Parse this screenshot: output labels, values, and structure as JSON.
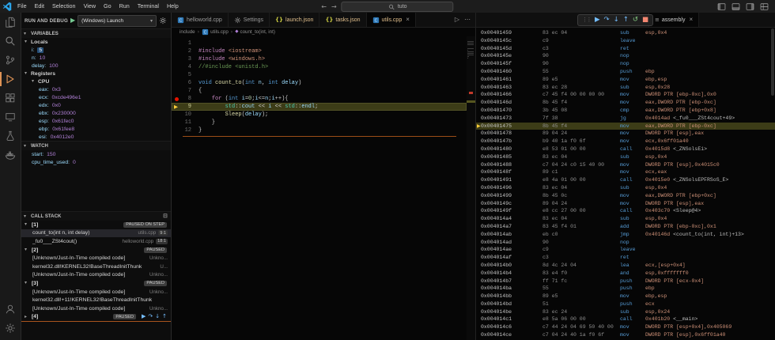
{
  "icons": {
    "close": "×",
    "chevron_down": "▾",
    "chevron_right": "▸",
    "crumb_sep": "›",
    "run": "▷",
    "more": "⋯",
    "collapse_all": "⊟",
    "dropdown": "▾",
    "back": "←",
    "forward": "→",
    "disassembly_view": "≡",
    "drag_handle": "⋮⋮"
  },
  "title_bar": {
    "menus": [
      "File",
      "Edit",
      "Selection",
      "View",
      "Go",
      "Run",
      "Terminal",
      "Help"
    ],
    "command_center": "tuto"
  },
  "activity_bar": {
    "items": [
      {
        "name": "explorer",
        "active": false
      },
      {
        "name": "search",
        "active": false
      },
      {
        "name": "source-control",
        "active": false
      },
      {
        "name": "run-and-debug",
        "active": true
      },
      {
        "name": "extensions",
        "active": false
      },
      {
        "name": "remote-explorer",
        "active": false
      },
      {
        "name": "testing",
        "active": false
      },
      {
        "name": "docker",
        "active": false
      }
    ],
    "bottom_items": [
      {
        "name": "accounts"
      },
      {
        "name": "settings"
      }
    ]
  },
  "run_and_debug": {
    "title": "RUN AND DEBUG",
    "launch_config": "(Windows) Launch",
    "variables": {
      "label": "VARIABLES",
      "rows": [
        {
          "kind": "group",
          "label": "Locals",
          "depth": 0
        },
        {
          "kind": "var",
          "name": "i",
          "value": "5",
          "depth": 1,
          "selected": true
        },
        {
          "kind": "var",
          "name": "n",
          "value": "10",
          "depth": 1
        },
        {
          "kind": "var",
          "name": "delay",
          "value": "100",
          "depth": 1
        },
        {
          "kind": "group",
          "label": "Registers",
          "depth": 0
        },
        {
          "kind": "group",
          "label": "CPU",
          "depth": 1
        },
        {
          "kind": "var",
          "name": "eax",
          "value": "0x3",
          "depth": 2
        },
        {
          "kind": "var",
          "name": "ecx",
          "value": "0xcde496e1",
          "depth": 2
        },
        {
          "kind": "var",
          "name": "edx",
          "value": "0x0",
          "depth": 2
        },
        {
          "kind": "var",
          "name": "ebx",
          "value": "0x230000",
          "depth": 2
        },
        {
          "kind": "var",
          "name": "esp",
          "value": "0x61fec0",
          "depth": 2
        },
        {
          "kind": "var",
          "name": "ebp",
          "value": "0x61fee8",
          "depth": 2
        },
        {
          "kind": "var",
          "name": "esi",
          "value": "0x4012e0",
          "depth": 2
        }
      ]
    },
    "watch": {
      "label": "WATCH",
      "rows": [
        {
          "kind": "var",
          "name": "start",
          "value": "150",
          "depth": 1
        },
        {
          "kind": "var",
          "name": "cpu_time_used",
          "value": "0",
          "depth": 1
        }
      ]
    },
    "call_stack": {
      "label": "CALL STACK",
      "threads": [
        {
          "label": "[1]",
          "status": "PAUSED ON STEP",
          "expanded": true,
          "frames": [
            {
              "name": "count_to(int n, int delay)",
              "file": "utils.cpp",
              "line": "9:1",
              "current": true
            },
            {
              "name": "_fu0___ZSt4cout()",
              "file": "helloworld.cpp",
              "line": "18:1"
            }
          ]
        },
        {
          "label": "[2]",
          "status": "PAUSED",
          "expanded": true,
          "frames": [
            {
              "name": "[Unknown/Just-In-Time compiled code]",
              "file": "Unkno..."
            },
            {
              "name": "kernel32.dll!KERNEL32!BaseThreadInitThunk",
              "file": "U..."
            },
            {
              "name": "[Unknown/Just-In-Time compiled code]",
              "file": "Unkno..."
            }
          ]
        },
        {
          "label": "[3]",
          "status": "PAUSED",
          "expanded": true,
          "frames": [
            {
              "name": "[Unknown/Just-In-Time compiled code]",
              "file": "Unkno..."
            },
            {
              "name": "kernel32.dll!+11!KERNEL32!BaseThreadInitThunk",
              "file": ""
            },
            {
              "name": "[Unknown/Just-In-Time compiled code]",
              "file": "Unkno..."
            }
          ]
        },
        {
          "label": "[4]",
          "status": "PAUSED",
          "expanded": false,
          "show_toolbar": true,
          "frames": []
        }
      ]
    }
  },
  "editor": {
    "tabs": [
      {
        "label": "helloworld.cpp",
        "icon": "cpp",
        "dirty": false,
        "active": false
      },
      {
        "label": "Settings",
        "icon": "gear",
        "dirty": false,
        "active": false
      },
      {
        "label": "launch.json",
        "icon": "json",
        "dirty": true,
        "active": false
      },
      {
        "label": "tasks.json",
        "icon": "json",
        "dirty": true,
        "active": false
      },
      {
        "label": "utils.cpp",
        "icon": "cpp",
        "dirty": true,
        "active": true
      }
    ],
    "breadcrumb": [
      {
        "label": "include",
        "icon": ""
      },
      {
        "label": "utils.cpp",
        "icon": "cpp"
      },
      {
        "label": "count_to(int, int)",
        "icon": "symbol-method"
      }
    ],
    "code_lines": [
      {
        "num": 1,
        "tokens": []
      },
      {
        "num": 2,
        "tokens": [
          [
            "pp",
            "#include"
          ],
          [
            "pl",
            " "
          ],
          [
            "str",
            "<iostream>"
          ]
        ]
      },
      {
        "num": 3,
        "tokens": [
          [
            "pp",
            "#include"
          ],
          [
            "pl",
            " "
          ],
          [
            "str",
            "<windows.h>"
          ]
        ]
      },
      {
        "num": 4,
        "tokens": [
          [
            "cm",
            "//#include <unistd.h>"
          ]
        ]
      },
      {
        "num": 5,
        "tokens": []
      },
      {
        "num": 6,
        "tokens": [
          [
            "kw",
            "void"
          ],
          [
            "pl",
            " "
          ],
          [
            "fn",
            "count_to"
          ],
          [
            "pl",
            "("
          ],
          [
            "kw",
            "int"
          ],
          [
            "pl",
            " "
          ],
          [
            "vr",
            "n"
          ],
          [
            "pl",
            ", "
          ],
          [
            "kw",
            "int"
          ],
          [
            "pl",
            " "
          ],
          [
            "vr",
            "delay"
          ],
          [
            "pl",
            ")"
          ]
        ]
      },
      {
        "num": 7,
        "tokens": [
          [
            "pl",
            "{"
          ]
        ]
      },
      {
        "num": 8,
        "breakpoint": true,
        "tokens": [
          [
            "pl",
            "    "
          ],
          [
            "ctl",
            "for"
          ],
          [
            "pl",
            " ("
          ],
          [
            "kw",
            "int"
          ],
          [
            "pl",
            " "
          ],
          [
            "vr",
            "i"
          ],
          [
            "pl",
            "="
          ],
          [
            "num",
            "0"
          ],
          [
            "pl",
            ";"
          ],
          [
            "vr",
            "i"
          ],
          [
            "pl",
            "<="
          ],
          [
            "vr",
            "n"
          ],
          [
            "pl",
            ";"
          ],
          [
            "vr",
            "i"
          ],
          [
            "pl",
            "++){"
          ]
        ]
      },
      {
        "num": 9,
        "current": true,
        "tokens": [
          [
            "pl",
            "        "
          ],
          [
            "ty",
            "std"
          ],
          [
            "pl",
            "::"
          ],
          [
            "vr",
            "cout"
          ],
          [
            "pl",
            " << "
          ],
          [
            "vr",
            "i"
          ],
          [
            "pl",
            " << "
          ],
          [
            "ty",
            "std"
          ],
          [
            "pl",
            "::"
          ],
          [
            "vr",
            "endl"
          ],
          [
            "pl",
            ";"
          ]
        ]
      },
      {
        "num": 10,
        "tokens": [
          [
            "pl",
            "        "
          ],
          [
            "fn",
            "Sleep"
          ],
          [
            "pl",
            "("
          ],
          [
            "vr",
            "delay"
          ],
          [
            "pl",
            ");"
          ]
        ]
      },
      {
        "num": 11,
        "tokens": [
          [
            "pl",
            "    }"
          ]
        ]
      },
      {
        "num": 12,
        "tokens": [
          [
            "pl",
            "}"
          ]
        ]
      }
    ]
  },
  "debug_toolbar": {
    "buttons": [
      {
        "name": "continue",
        "glyph": "▶",
        "color": "#75beff"
      },
      {
        "name": "step-over",
        "glyph": "↷",
        "color": "#75beff"
      },
      {
        "name": "step-into",
        "glyph": "↓",
        "color": "#75beff"
      },
      {
        "name": "step-out",
        "glyph": "↑",
        "color": "#75beff"
      },
      {
        "name": "restart",
        "glyph": "↺",
        "color": "#89d185"
      },
      {
        "name": "stop",
        "glyph": "■",
        "color": "#f48771"
      }
    ]
  },
  "disassembly": {
    "tab_label": "assembly",
    "lines": [
      {
        "addr": "0x00401459",
        "bytes": "83 ec 04",
        "op": "sub",
        "args": "esp,0x4"
      },
      {
        "addr": "0x0040145c",
        "bytes": "c9",
        "op": "leave",
        "args": ""
      },
      {
        "addr": "0x0040145d",
        "bytes": "c3",
        "op": "ret",
        "args": ""
      },
      {
        "addr": "0x0040145e",
        "bytes": "90",
        "op": "nop",
        "args": ""
      },
      {
        "addr": "0x0040145f",
        "bytes": "90",
        "op": "nop",
        "args": ""
      },
      {
        "addr": "0x00401460",
        "bytes": "55",
        "op": "push",
        "args": "ebp"
      },
      {
        "addr": "0x00401461",
        "bytes": "89 e5",
        "op": "mov",
        "args": "ebp,esp"
      },
      {
        "addr": "0x00401463",
        "bytes": "83 ec 28",
        "op": "sub",
        "args": "esp,0x28"
      },
      {
        "addr": "0x00401466",
        "bytes": "c7 45 f4 00 00 00 00",
        "op": "mov",
        "args": "DWORD PTR [ebp-0xc],0x0"
      },
      {
        "addr": "0x0040146d",
        "bytes": "8b 45 f4",
        "op": "mov",
        "args": "eax,DWORD PTR [ebp-0xc]"
      },
      {
        "addr": "0x00401470",
        "bytes": "3b 45 08",
        "op": "cmp",
        "args": "eax,DWORD PTR [ebp+0x8]"
      },
      {
        "addr": "0x00401473",
        "bytes": "7f 38",
        "op": "jg",
        "args": "0x4014ad",
        "sym": "<_fu0___ZSt4cout+49>"
      },
      {
        "addr": "0x00401475",
        "bytes": "8b 45 f4",
        "op": "mov",
        "args": "eax,DWORD PTR [ebp-0xc]",
        "current": true
      },
      {
        "addr": "0x00401478",
        "bytes": "89 04 24",
        "op": "mov",
        "args": "DWORD PTR [esp],eax"
      },
      {
        "addr": "0x0040147b",
        "bytes": "b9 40 1a f0 6f",
        "op": "mov",
        "args": "ecx,0x6ff01a40"
      },
      {
        "addr": "0x00401480",
        "bytes": "e8 53 01 00 00",
        "op": "call",
        "args": "0x4015d8",
        "sym": "<_ZNSolsEi>"
      },
      {
        "addr": "0x00401485",
        "bytes": "83 ec 04",
        "op": "sub",
        "args": "esp,0x4"
      },
      {
        "addr": "0x00401488",
        "bytes": "c7 04 24 c0 15 40 00",
        "op": "mov",
        "args": "DWORD PTR [esp],0x4015c0"
      },
      {
        "addr": "0x0040148f",
        "bytes": "89 c1",
        "op": "mov",
        "args": "ecx,eax"
      },
      {
        "addr": "0x00401491",
        "bytes": "e8 4a 01 00 00",
        "op": "call",
        "args": "0x4015e0",
        "sym": "<_ZNSolsEPFRSoS_E>"
      },
      {
        "addr": "0x00401496",
        "bytes": "83 ec 04",
        "op": "sub",
        "args": "esp,0x4"
      },
      {
        "addr": "0x00401499",
        "bytes": "8b 45 0c",
        "op": "mov",
        "args": "eax,DWORD PTR [ebp+0xc]"
      },
      {
        "addr": "0x0040149c",
        "bytes": "89 04 24",
        "op": "mov",
        "args": "DWORD PTR [esp],eax"
      },
      {
        "addr": "0x0040149f",
        "bytes": "e8 cc 27 00 00",
        "op": "call",
        "args": "0x403c70",
        "sym": "<Sleep@4>"
      },
      {
        "addr": "0x004014a4",
        "bytes": "83 ec 04",
        "op": "sub",
        "args": "esp,0x4"
      },
      {
        "addr": "0x004014a7",
        "bytes": "83 45 f4 01",
        "op": "add",
        "args": "DWORD PTR [ebp-0xc],0x1"
      },
      {
        "addr": "0x004014ab",
        "bytes": "eb c0",
        "op": "jmp",
        "args": "0x40146d",
        "sym": "<count_to(int, int)+13>"
      },
      {
        "addr": "0x004014ad",
        "bytes": "90",
        "op": "nop",
        "args": ""
      },
      {
        "addr": "0x004014ae",
        "bytes": "c9",
        "op": "leave",
        "args": ""
      },
      {
        "addr": "0x004014af",
        "bytes": "c3",
        "op": "ret",
        "args": ""
      },
      {
        "addr": "0x004014b0",
        "bytes": "8d 4c 24 04",
        "op": "lea",
        "args": "ecx,[esp+0x4]"
      },
      {
        "addr": "0x004014b4",
        "bytes": "83 e4 f0",
        "op": "and",
        "args": "esp,0xfffffff0"
      },
      {
        "addr": "0x004014b7",
        "bytes": "ff 71 fc",
        "op": "push",
        "args": "DWORD PTR [ecx-0x4]"
      },
      {
        "addr": "0x004014ba",
        "bytes": "55",
        "op": "push",
        "args": "ebp"
      },
      {
        "addr": "0x004014bb",
        "bytes": "89 e5",
        "op": "mov",
        "args": "ebp,esp"
      },
      {
        "addr": "0x004014bd",
        "bytes": "51",
        "op": "push",
        "args": "ecx"
      },
      {
        "addr": "0x004014be",
        "bytes": "83 ec 24",
        "op": "sub",
        "args": "esp,0x24"
      },
      {
        "addr": "0x004014c1",
        "bytes": "e8 5a 06 00 00",
        "op": "call",
        "args": "0x401b20",
        "sym": "<__main>"
      },
      {
        "addr": "0x004014c6",
        "bytes": "c7 44 24 04 69 50 40 00",
        "op": "mov",
        "args": "DWORD PTR [esp+0x4],0x405069"
      },
      {
        "addr": "0x004014ce",
        "bytes": "c7 04 24 40 1a f0 6f",
        "op": "mov",
        "args": "DWORD PTR [esp],0x6ff01a40"
      }
    ]
  }
}
